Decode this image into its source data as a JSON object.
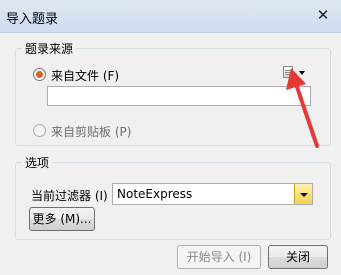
{
  "window": {
    "title": "导入题录",
    "close_glyph": "✕"
  },
  "source_group": {
    "title": "题录来源",
    "from_file_label": "来自文件 (F)",
    "file_path_value": "",
    "from_clipboard_label": "来自剪贴板 (P)"
  },
  "options_group": {
    "title": "选项",
    "filter_label": "当前过滤器 (I)",
    "filter_value": "NoteExpress",
    "more_label": "更多 (M)..."
  },
  "buttons": {
    "start_import": "开始导入 (I)",
    "close": "关闭"
  },
  "icons": {
    "file_browse": "file-icon",
    "dropdown": "chevron-down-icon"
  },
  "colors": {
    "annotation_arrow": "#e53935",
    "radio_selected": "#e0601e",
    "combo_arrow": "#f7cf4c"
  }
}
